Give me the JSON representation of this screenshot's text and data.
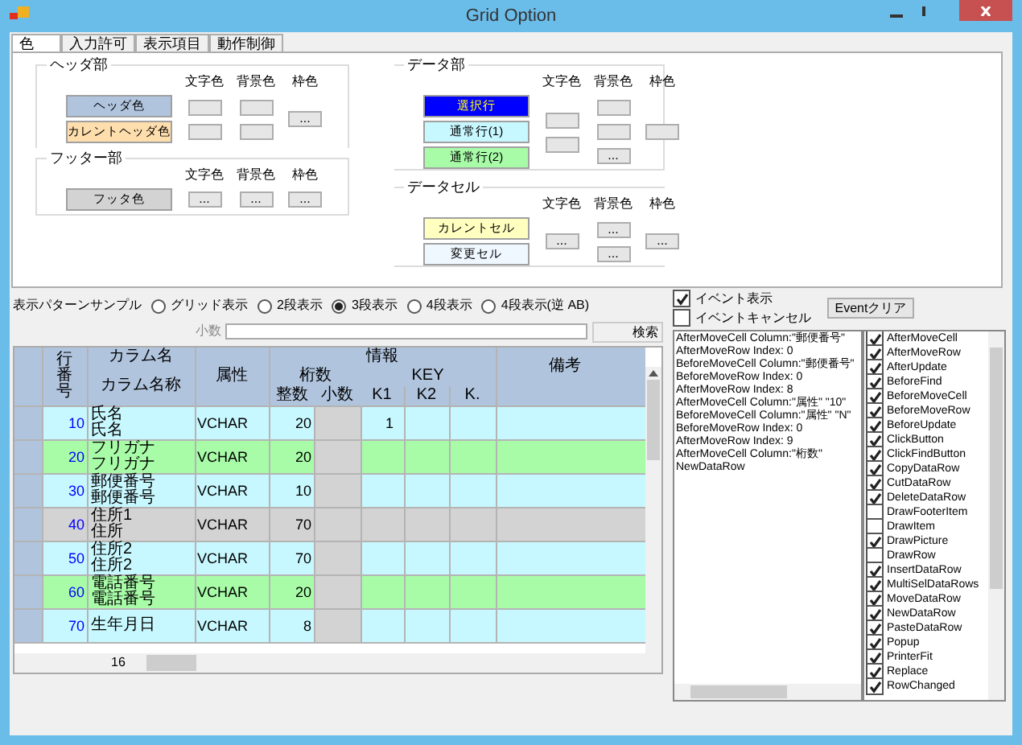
{
  "window": {
    "title": "Grid Option"
  },
  "tabs": [
    {
      "label": "色",
      "selected": true
    },
    {
      "label": "入力許可",
      "selected": false
    },
    {
      "label": "表示項目",
      "selected": false
    },
    {
      "label": "動作制御",
      "selected": false
    }
  ],
  "sections": [
    {
      "title": "ヘッダ部",
      "swatches": [
        {
          "label": "ヘッダ色",
          "color": "#b0c4de",
          "kind": "normal"
        },
        {
          "label": "カレントヘッダ色",
          "color": "#ffdead",
          "kind": "normal"
        }
      ],
      "columns": [
        {
          "heading": "文字色",
          "buttons": [
            {
              "kind": "blank"
            },
            {
              "kind": "blank"
            }
          ]
        },
        {
          "heading": "背景色",
          "buttons": [
            {
              "kind": "blank"
            },
            {
              "kind": "blank"
            }
          ]
        },
        {
          "heading": "枠色",
          "buttons": [
            {
              "kind": "dots",
              "label": "..."
            }
          ]
        }
      ]
    },
    {
      "title": "フッター部",
      "swatches": [
        {
          "label": "フッタ色",
          "color": "#d3d3d3",
          "kind": "normal"
        }
      ],
      "columns": [
        {
          "heading": "文字色",
          "buttons": [
            {
              "kind": "dots",
              "label": "..."
            }
          ]
        },
        {
          "heading": "背景色",
          "buttons": [
            {
              "kind": "dots",
              "label": "..."
            }
          ]
        },
        {
          "heading": "枠色",
          "buttons": [
            {
              "kind": "dots",
              "label": "..."
            }
          ]
        }
      ]
    },
    {
      "title": "データ部",
      "swatches": [
        {
          "label": "選択行",
          "color": "#0000ff",
          "kind": "inverse"
        },
        {
          "label": "通常行(1)",
          "color": "#c8f8ff",
          "kind": "normal"
        },
        {
          "label": "通常行(2)",
          "color": "#a8fca8",
          "kind": "normal"
        }
      ],
      "columns": [
        {
          "heading": "文字色",
          "buttons": [
            {
              "kind": "blank"
            },
            {
              "kind": "blank"
            }
          ]
        },
        {
          "heading": "背景色",
          "buttons": [
            {
              "kind": "blank"
            },
            {
              "kind": "blank"
            },
            {
              "kind": "dots",
              "label": "..."
            }
          ]
        },
        {
          "heading": "枠色",
          "buttons": [
            {
              "kind": "blank"
            }
          ]
        }
      ]
    },
    {
      "title": "データセル",
      "swatches": [
        {
          "label": "カレントセル",
          "color": "#ffffc0",
          "kind": "normal"
        },
        {
          "label": "変更セル",
          "color": "#f0f8ff",
          "kind": "normal"
        }
      ],
      "columns": [
        {
          "heading": "文字色",
          "buttons": [
            {
              "kind": "dots",
              "label": "..."
            }
          ]
        },
        {
          "heading": "背景色",
          "buttons": [
            {
              "kind": "dots",
              "label": "..."
            },
            {
              "kind": "dots",
              "label": "..."
            }
          ]
        },
        {
          "heading": "枠色",
          "buttons": [
            {
              "kind": "dots",
              "label": "..."
            }
          ]
        }
      ]
    }
  ],
  "pattern": {
    "label": "表示パターンサンプル",
    "options": [
      {
        "label": "グリッド表示",
        "selected": false
      },
      {
        "label": "2段表示",
        "selected": false
      },
      {
        "label": "3段表示",
        "selected": true
      },
      {
        "label": "4段表示",
        "selected": false
      },
      {
        "label": "4段表示(逆 AB)",
        "selected": false
      }
    ]
  },
  "search": {
    "label": "小数",
    "button": "検索"
  },
  "grid": {
    "headers": {
      "row_no": "行番号",
      "name": "カラム名",
      "caption": "カラム名称",
      "type": "属性",
      "info": "情報",
      "digits": "桁数",
      "int": "整数",
      "dec": "小数",
      "key": "KEY",
      "k1": "K1",
      "k2": "K2",
      "k3": "K.",
      "note": "備考"
    },
    "rows": [
      {
        "no": "10",
        "name": "氏名",
        "caption": "氏名",
        "type": "VCHAR",
        "int": "20",
        "k1": "1",
        "color": "#c8f8ff"
      },
      {
        "no": "20",
        "name": "フリガナ",
        "caption": "フリガナ",
        "type": "VCHAR",
        "int": "20",
        "color": "#a8fca8"
      },
      {
        "no": "30",
        "name": "郵便番号",
        "caption": "郵便番号",
        "type": "VCHAR",
        "int": "10",
        "color": "#c8f8ff"
      },
      {
        "no": "40",
        "name": "住所1",
        "caption": "住所",
        "type": "VCHAR",
        "int": "70",
        "color": "#d3d3d3"
      },
      {
        "no": "50",
        "name": "住所2",
        "caption": "住所2",
        "type": "VCHAR",
        "int": "70",
        "color": "#c8f8ff"
      },
      {
        "no": "60",
        "name": "電話番号",
        "caption": "電話番号",
        "type": "VCHAR",
        "int": "20",
        "color": "#a8fca8"
      },
      {
        "no": "70",
        "name": "生年月日",
        "type": "VCHAR",
        "int": "8",
        "color": "#c8f8ff"
      }
    ],
    "footer": "16"
  },
  "event_options": [
    {
      "label": "イベント表示",
      "checked": true
    },
    {
      "label": "イベントキャンセル",
      "checked": false
    }
  ],
  "event_button": "Eventクリア",
  "event_log": [
    "AfterMoveCell Column:\"郵便番号\"",
    "AfterMoveRow Index: 0",
    "BeforeMoveCell Column:\"郵便番号\"",
    "BeforeMoveRow Index: 0",
    "AfterMoveRow Index: 8",
    "AfterMoveCell Column:\"属性\" \"10\"",
    "BeforeMoveCell Column:\"属性\" \"N\"",
    "BeforeMoveRow Index: 0",
    "AfterMoveRow Index: 9",
    "AfterMoveCell Column:\"桁数\"",
    "NewDataRow"
  ],
  "events": [
    {
      "label": "AfterMoveCell",
      "checked": true
    },
    {
      "label": "AfterMoveRow",
      "checked": true
    },
    {
      "label": "AfterUpdate",
      "checked": true
    },
    {
      "label": "BeforeFind",
      "checked": true
    },
    {
      "label": "BeforeMoveCell",
      "checked": true
    },
    {
      "label": "BeforeMoveRow",
      "checked": true
    },
    {
      "label": "BeforeUpdate",
      "checked": true
    },
    {
      "label": "ClickButton",
      "checked": true
    },
    {
      "label": "ClickFindButton",
      "checked": true
    },
    {
      "label": "CopyDataRow",
      "checked": true
    },
    {
      "label": "CutDataRow",
      "checked": true
    },
    {
      "label": "DeleteDataRow",
      "checked": true
    },
    {
      "label": "DrawFooterItem",
      "checked": false
    },
    {
      "label": "DrawItem",
      "checked": false
    },
    {
      "label": "DrawPicture",
      "checked": true
    },
    {
      "label": "DrawRow",
      "checked": false
    },
    {
      "label": "InsertDataRow",
      "checked": true
    },
    {
      "label": "MultiSelDataRows",
      "checked": true
    },
    {
      "label": "MoveDataRow",
      "checked": true
    },
    {
      "label": "NewDataRow",
      "checked": true
    },
    {
      "label": "PasteDataRow",
      "checked": true
    },
    {
      "label": "Popup",
      "checked": true
    },
    {
      "label": "PrinterFit",
      "checked": true
    },
    {
      "label": "Replace",
      "checked": true
    },
    {
      "label": "RowChanged",
      "checked": true
    }
  ]
}
